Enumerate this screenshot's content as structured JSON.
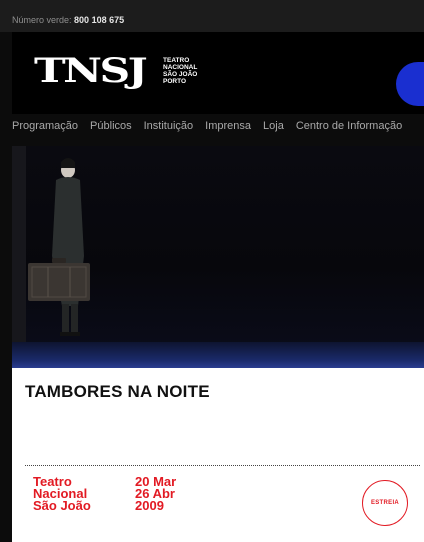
{
  "topbar": {
    "hotline_label": "Número verde:",
    "hotline_number": "800 108 675"
  },
  "header": {
    "logo_text": "TNSJ",
    "logo_sub": [
      "TEATRO",
      "NACIONAL",
      "SÃO JOÃO",
      "PORTO"
    ]
  },
  "nav": {
    "items": [
      "Programação",
      "Públicos",
      "Instituição",
      "Imprensa",
      "Loja",
      "Centro de Informação"
    ]
  },
  "show": {
    "title": "TAMBORES NA NOITE",
    "venue": [
      "Teatro",
      "Nacional",
      "São João"
    ],
    "dates": [
      "20 Mar",
      "26 Abr",
      "2009"
    ],
    "badge": "ESTREIA"
  },
  "colors": {
    "accent": "#e21a23",
    "brand_blue": "#1a2fd0"
  }
}
